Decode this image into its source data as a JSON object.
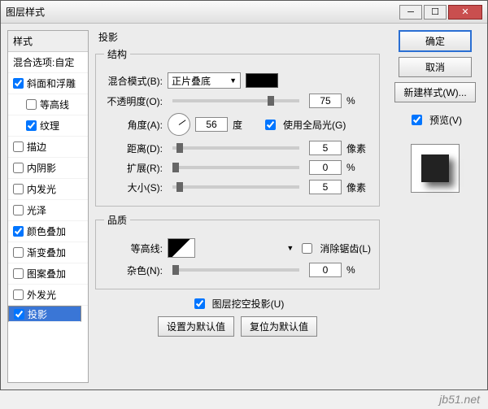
{
  "window": {
    "title": "图层样式"
  },
  "sidebar": {
    "header": "样式",
    "blend_row": "混合选项:自定",
    "items": [
      {
        "label": "斜面和浮雕",
        "checked": true,
        "indent": 0
      },
      {
        "label": "等高线",
        "checked": false,
        "indent": 1
      },
      {
        "label": "纹理",
        "checked": true,
        "indent": 1
      },
      {
        "label": "描边",
        "checked": false,
        "indent": 0
      },
      {
        "label": "内阴影",
        "checked": false,
        "indent": 0
      },
      {
        "label": "内发光",
        "checked": false,
        "indent": 0
      },
      {
        "label": "光泽",
        "checked": false,
        "indent": 0
      },
      {
        "label": "颜色叠加",
        "checked": true,
        "indent": 0
      },
      {
        "label": "渐变叠加",
        "checked": false,
        "indent": 0
      },
      {
        "label": "图案叠加",
        "checked": false,
        "indent": 0
      },
      {
        "label": "外发光",
        "checked": false,
        "indent": 0
      },
      {
        "label": "投影",
        "checked": true,
        "indent": 0,
        "selected": true
      }
    ]
  },
  "panel": {
    "title": "投影",
    "group_structure": "结构",
    "blend_mode_label": "混合模式(B):",
    "blend_mode_value": "正片叠底",
    "opacity_label": "不透明度(O):",
    "opacity_value": "75",
    "opacity_unit": "%",
    "angle_label": "角度(A):",
    "angle_value": "56",
    "angle_unit": "度",
    "global_light_label": "使用全局光(G)",
    "global_light_checked": true,
    "distance_label": "距离(D):",
    "distance_value": "5",
    "distance_unit": "像素",
    "spread_label": "扩展(R):",
    "spread_value": "0",
    "spread_unit": "%",
    "size_label": "大小(S):",
    "size_value": "5",
    "size_unit": "像素",
    "group_quality": "品质",
    "contour_label": "等高线:",
    "antialias_label": "消除锯齿(L)",
    "antialias_checked": false,
    "noise_label": "杂色(N):",
    "noise_value": "0",
    "noise_unit": "%",
    "knockout_label": "图层挖空投影(U)",
    "knockout_checked": true,
    "btn_default": "设置为默认值",
    "btn_reset": "复位为默认值"
  },
  "right": {
    "ok": "确定",
    "cancel": "取消",
    "new_style": "新建样式(W)...",
    "preview_label": "预览(V)",
    "preview_checked": true
  },
  "watermark": "jb51.net"
}
